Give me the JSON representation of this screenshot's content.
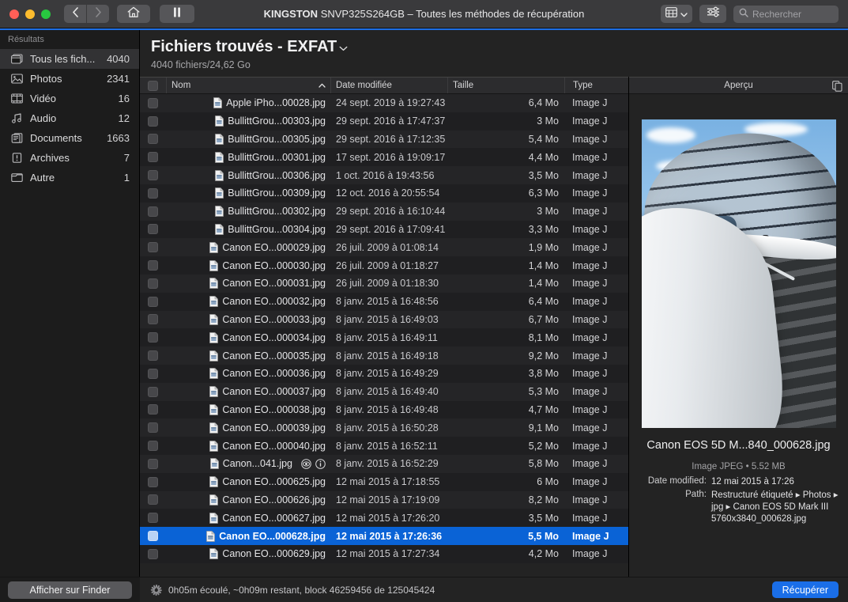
{
  "titlebar": {
    "window_title_device": "KINGSTON",
    "window_title_rest": "SNVP325S264GB – Toutes les méthodes de récupération",
    "back_icon": "chevron-left-icon",
    "forward_icon": "chevron-right-icon",
    "home_icon": "home-icon",
    "pause_icon": "pause-icon",
    "viewmode_icon": "list-view-icon",
    "viewmode_caret": "chevron-down-icon",
    "filter_icon": "sliders-icon",
    "search_icon": "search-icon",
    "search_placeholder": "Rechercher",
    "search_value": ""
  },
  "sidebar": {
    "title": "Résultats",
    "items": [
      {
        "label": "Tous les fich...",
        "count": "4040",
        "icon": "all-files-icon",
        "selected": true
      },
      {
        "label": "Photos",
        "count": "2341",
        "icon": "photo-icon",
        "selected": false
      },
      {
        "label": "Vidéo",
        "count": "16",
        "icon": "video-icon",
        "selected": false
      },
      {
        "label": "Audio",
        "count": "12",
        "icon": "audio-icon",
        "selected": false
      },
      {
        "label": "Documents",
        "count": "1663",
        "icon": "document-icon",
        "selected": false
      },
      {
        "label": "Archives",
        "count": "7",
        "icon": "archive-icon",
        "selected": false
      },
      {
        "label": "Autre",
        "count": "1",
        "icon": "other-icon",
        "selected": false
      }
    ],
    "finder_button": "Afficher sur Finder"
  },
  "main": {
    "title": "Fichiers trouvés - EXFAT",
    "title_caret": "chevron-down-icon",
    "subtitle": "4040 fichiers/24,62 Go",
    "columns": {
      "check": "",
      "name": "Nom",
      "sort_caret": "chevron-up-icon",
      "date": "Date modifiée",
      "size": "Taille",
      "type": "Type"
    },
    "rows": [
      {
        "name": "Apple iPho...00028.jpg",
        "date": "24 sept. 2019 à 19:27:43",
        "size": "6,4 Mo",
        "type": "Image J",
        "selected": false
      },
      {
        "name": "BullittGrou...00303.jpg",
        "date": "29 sept. 2016 à 17:47:37",
        "size": "3 Mo",
        "type": "Image J",
        "selected": false
      },
      {
        "name": "BullittGrou...00305.jpg",
        "date": "29 sept. 2016 à 17:12:35",
        "size": "5,4 Mo",
        "type": "Image J",
        "selected": false
      },
      {
        "name": "BullittGrou...00301.jpg",
        "date": "17 sept. 2016 à 19:09:17",
        "size": "4,4 Mo",
        "type": "Image J",
        "selected": false
      },
      {
        "name": "BullittGrou...00306.jpg",
        "date": "1 oct. 2016 à 19:43:56",
        "size": "3,5 Mo",
        "type": "Image J",
        "selected": false
      },
      {
        "name": "BullittGrou...00309.jpg",
        "date": "12 oct. 2016 à 20:55:54",
        "size": "6,3 Mo",
        "type": "Image J",
        "selected": false
      },
      {
        "name": "BullittGrou...00302.jpg",
        "date": "29 sept. 2016 à 16:10:44",
        "size": "3 Mo",
        "type": "Image J",
        "selected": false
      },
      {
        "name": "BullittGrou...00304.jpg",
        "date": "29 sept. 2016 à 17:09:41",
        "size": "3,3 Mo",
        "type": "Image J",
        "selected": false
      },
      {
        "name": "Canon EO...000029.jpg",
        "date": "26 juil. 2009 à 01:08:14",
        "size": "1,9 Mo",
        "type": "Image J",
        "selected": false
      },
      {
        "name": "Canon EO...000030.jpg",
        "date": "26 juil. 2009 à 01:18:27",
        "size": "1,4 Mo",
        "type": "Image J",
        "selected": false
      },
      {
        "name": "Canon EO...000031.jpg",
        "date": "26 juil. 2009 à 01:18:30",
        "size": "1,4 Mo",
        "type": "Image J",
        "selected": false
      },
      {
        "name": "Canon EO...000032.jpg",
        "date": "8 janv. 2015 à 16:48:56",
        "size": "6,4 Mo",
        "type": "Image J",
        "selected": false
      },
      {
        "name": "Canon EO...000033.jpg",
        "date": "8 janv. 2015 à 16:49:03",
        "size": "6,7 Mo",
        "type": "Image J",
        "selected": false
      },
      {
        "name": "Canon EO...000034.jpg",
        "date": "8 janv. 2015 à 16:49:11",
        "size": "8,1 Mo",
        "type": "Image J",
        "selected": false
      },
      {
        "name": "Canon EO...000035.jpg",
        "date": "8 janv. 2015 à 16:49:18",
        "size": "9,2 Mo",
        "type": "Image J",
        "selected": false
      },
      {
        "name": "Canon EO...000036.jpg",
        "date": "8 janv. 2015 à 16:49:29",
        "size": "3,8 Mo",
        "type": "Image J",
        "selected": false
      },
      {
        "name": "Canon EO...000037.jpg",
        "date": "8 janv. 2015 à 16:49:40",
        "size": "5,3 Mo",
        "type": "Image J",
        "selected": false
      },
      {
        "name": "Canon EO...000038.jpg",
        "date": "8 janv. 2015 à 16:49:48",
        "size": "4,7 Mo",
        "type": "Image J",
        "selected": false
      },
      {
        "name": "Canon EO...000039.jpg",
        "date": "8 janv. 2015 à 16:50:28",
        "size": "9,1 Mo",
        "type": "Image J",
        "selected": false
      },
      {
        "name": "Canon EO...000040.jpg",
        "date": "8 janv. 2015 à 16:52:11",
        "size": "5,2 Mo",
        "type": "Image J",
        "selected": false
      },
      {
        "name": "Canon...041.jpg",
        "date": "8 janv. 2015 à 16:52:29",
        "size": "5,8 Mo",
        "type": "Image J",
        "selected": false,
        "hover_icons": [
          "preview-eye-icon",
          "info-icon"
        ]
      },
      {
        "name": "Canon EO...000625.jpg",
        "date": "12 mai 2015 à 17:18:55",
        "size": "6 Mo",
        "type": "Image J",
        "selected": false
      },
      {
        "name": "Canon EO...000626.jpg",
        "date": "12 mai 2015 à 17:19:09",
        "size": "8,2 Mo",
        "type": "Image J",
        "selected": false
      },
      {
        "name": "Canon EO...000627.jpg",
        "date": "12 mai 2015 à 17:26:20",
        "size": "3,5 Mo",
        "type": "Image J",
        "selected": false
      },
      {
        "name": "Canon EO...000628.jpg",
        "date": "12 mai 2015 à 17:26:36",
        "size": "5,5 Mo",
        "type": "Image J",
        "selected": true
      },
      {
        "name": "Canon EO...000629.jpg",
        "date": "12 mai 2015 à 17:27:34",
        "size": "4,2 Mo",
        "type": "Image J",
        "selected": false
      }
    ]
  },
  "preview": {
    "header": "Aperçu",
    "copy_icon": "copy-icon",
    "image_alt": "photo-city-hall-stairs",
    "filename": "Canon EOS 5D M...840_000628.jpg",
    "meta": "Image JPEG • 5.52 MB",
    "date_key": "Date modified:",
    "date_value": "12 mai 2015 à 17:26",
    "path_key": "Path:",
    "path_value": "Restructuré étiqueté ▸ Photos ▸ jpg ▸ Canon EOS 5D Mark III 5760x3840_000628.jpg"
  },
  "statusbar": {
    "progress_text": "0h05m écoulé, ~0h09m restant, block 46259456 de 125045424",
    "spinner_icon": "spinner-icon",
    "recover_button": "Récupérer"
  },
  "colors": {
    "accent_blue": "#1a6ee8",
    "selection_blue": "#0a63d6",
    "titlebar": "#3a3a3c",
    "sidebar_bg": "#1c1c1c",
    "content_bg": "#232323",
    "traffic_red": "#ff5f57",
    "traffic_yellow": "#febc2e",
    "traffic_green": "#28c840"
  }
}
